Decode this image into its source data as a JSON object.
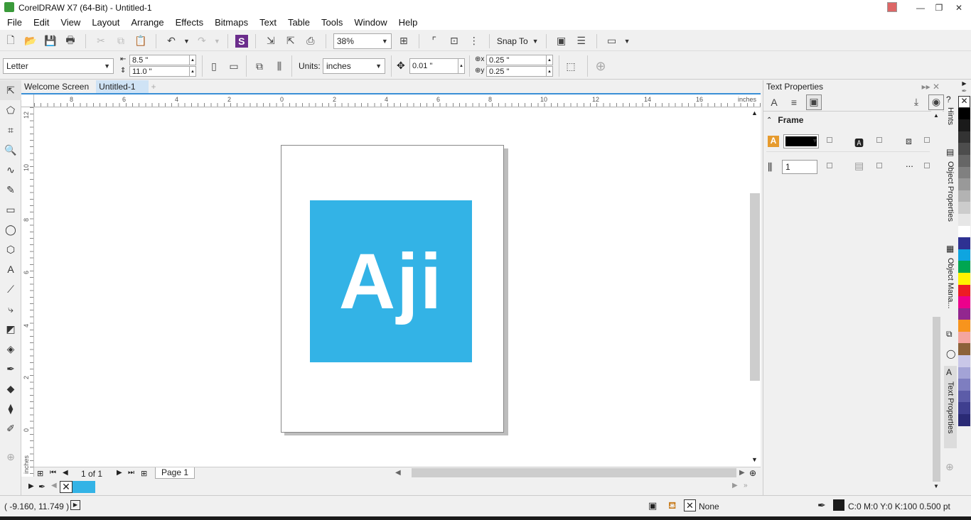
{
  "window": {
    "title": "CorelDRAW X7 (64-Bit) - Untitled-1",
    "min": "—",
    "max": "❐",
    "close": "✕"
  },
  "menu": [
    "File",
    "Edit",
    "View",
    "Layout",
    "Arrange",
    "Effects",
    "Bitmaps",
    "Text",
    "Table",
    "Tools",
    "Window",
    "Help"
  ],
  "toolbar": {
    "zoom": "38%",
    "snap_to": "Snap To"
  },
  "propbar": {
    "paper": "Letter",
    "width": "8.5 \"",
    "height": "11.0 \"",
    "units_label": "Units:",
    "units": "inches",
    "nudge": "0.01 \"",
    "dup_x": "0.25 \"",
    "dup_y": "0.25 \""
  },
  "tabs": {
    "welcome": "Welcome Screen",
    "doc": "Untitled-1",
    "add": "+"
  },
  "ruler": {
    "h_labels": [
      "8",
      "6",
      "4",
      "2",
      "0",
      "2",
      "4",
      "6",
      "8",
      "10",
      "12",
      "14",
      "16"
    ],
    "h_unit": "inches",
    "v_labels": [
      "12",
      "10",
      "8",
      "6",
      "4",
      "2",
      "0"
    ],
    "v_unit": "inches"
  },
  "artwork": {
    "text": "Aji",
    "color": "#33b3e6"
  },
  "pages": {
    "count_text": "1 of 1",
    "page_tab": "Page 1"
  },
  "docker": {
    "title": "Text Properties",
    "section": "Frame",
    "columns_value": "1",
    "more": "..."
  },
  "docker_tabs": [
    "Hints",
    "Object Properties",
    "Object Mana...",
    "Text Properties"
  ],
  "palette": [
    "#ffffff",
    "#000000",
    "#1a1a1a",
    "#333333",
    "#4d4d4d",
    "#666666",
    "#808080",
    "#999999",
    "#b3b3b3",
    "#cccccc",
    "#e6e6e6",
    "#ffffff",
    "#2e3192",
    "#0ea5e0",
    "#00a651",
    "#fff200",
    "#ed1c24",
    "#ec008c",
    "#92278f",
    "#f7941d",
    "#f4a5a0",
    "#8c6239",
    "#c9c7e8",
    "#a3a3d6",
    "#7e7ec0",
    "#5c5ca8",
    "#3f3f8f",
    "#2a2a75"
  ],
  "doc_palette": [
    "#33b3e6",
    "#33b3e6"
  ],
  "status": {
    "coords": "( -9.160, 11.749 )",
    "fill": "None",
    "outline": "C:0 M:0 Y:0 K:100  0.500 pt"
  }
}
